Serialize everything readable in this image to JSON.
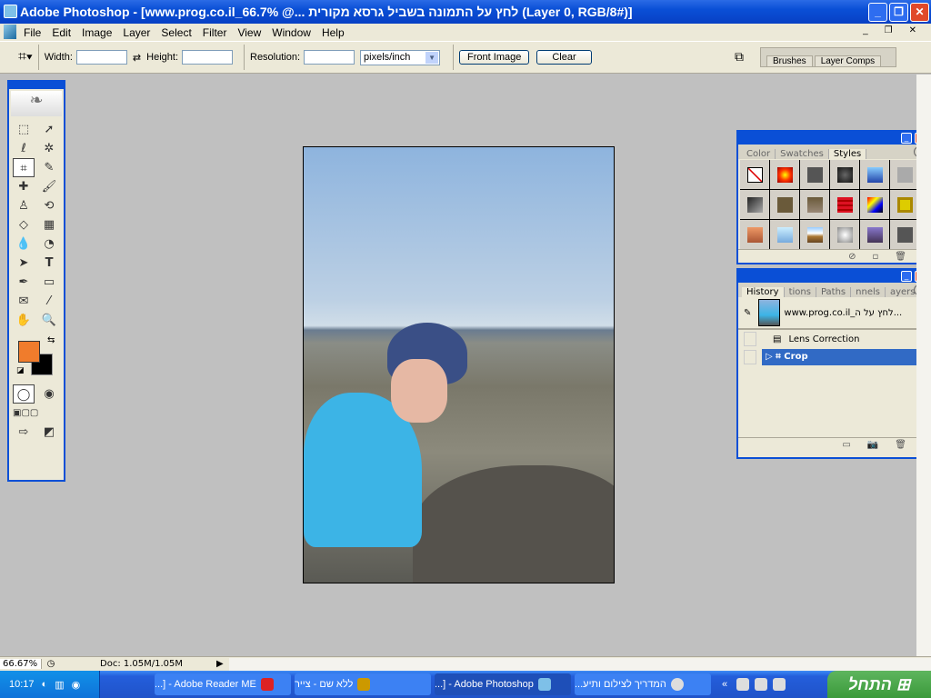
{
  "window": {
    "title": "Adobe Photoshop - [www.prog.co.il_66.7% @... לחץ על התמונה בשביל גרסא מקורית (Layer 0, RGB/8#)]"
  },
  "menu": [
    "File",
    "Edit",
    "Image",
    "Layer",
    "Select",
    "Filter",
    "View",
    "Window",
    "Help"
  ],
  "options": {
    "width_label": "Width:",
    "width_value": "",
    "height_label": "Height:",
    "height_value": "",
    "resolution_label": "Resolution:",
    "resolution_value": "",
    "units": "pixels/inch",
    "front_image": "Front Image",
    "clear": "Clear"
  },
  "well_tabs": [
    "Brushes",
    "Layer Comps"
  ],
  "colors": {
    "foreground": "#f07c2c",
    "background": "#000000"
  },
  "styles_panel": {
    "tabs": [
      "Color",
      "Swatches",
      "Styles"
    ],
    "active": "Styles"
  },
  "history_panel": {
    "tabs": [
      "History",
      "tions",
      "Paths",
      "nnels",
      "ayers"
    ],
    "snapshot": "www.prog.co.il_לחץ על ה...",
    "items": [
      "Lens Correction",
      "Crop"
    ],
    "selected": "Crop"
  },
  "status": {
    "zoom": "66.67%",
    "doc": "Doc: 1.05M/1.05M"
  },
  "taskbar": {
    "clock": "10:17",
    "tasks": [
      "...] - Adobe Reader ME",
      "ללא שם - צייר",
      "...] - Adobe Photoshop",
      "המדריך לצילום ותיע..."
    ],
    "active_task": "...] - Adobe Photoshop",
    "start": "התחל"
  }
}
